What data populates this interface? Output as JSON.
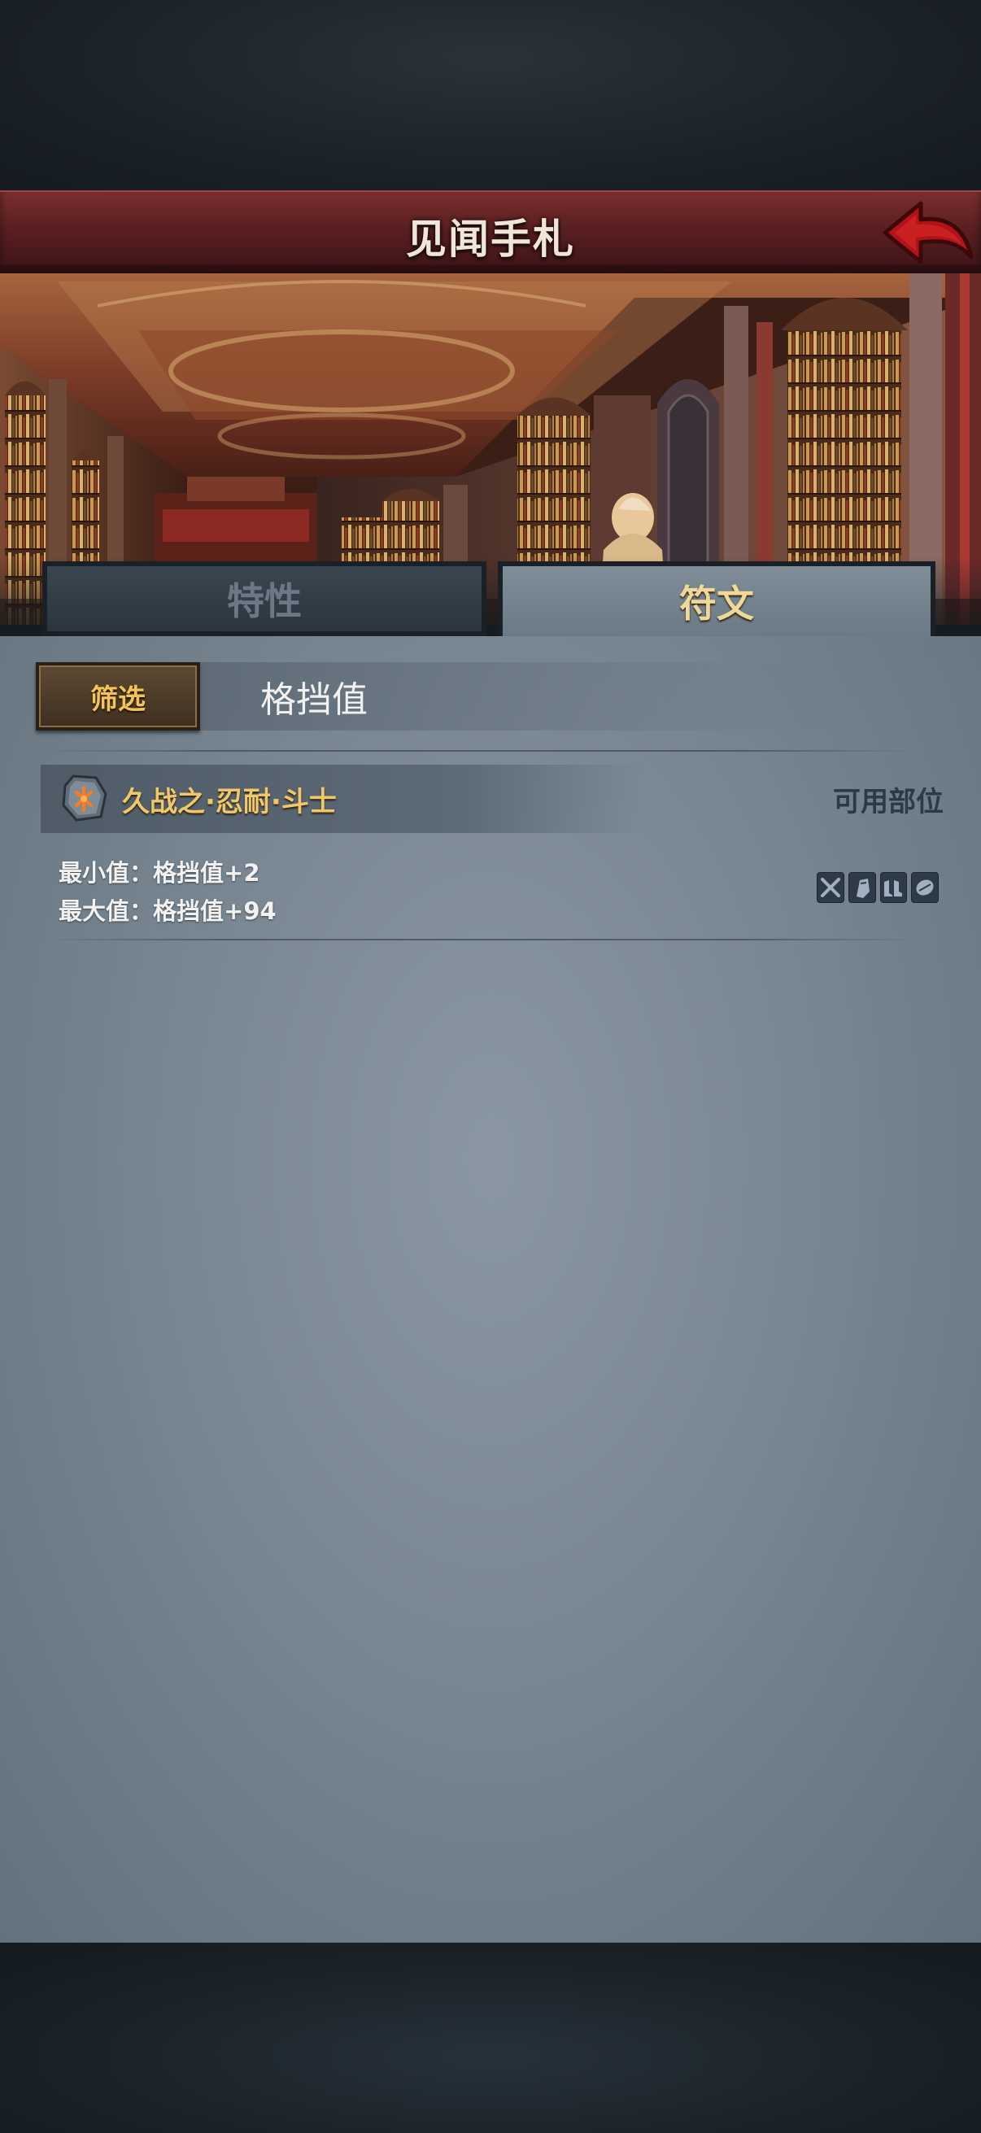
{
  "header": {
    "title": "见闻手札"
  },
  "tabs": [
    {
      "label": "特性",
      "active": false
    },
    {
      "label": "符文",
      "active": true
    }
  ],
  "filter": {
    "button_label": "筛选",
    "selected_value": "格挡值"
  },
  "rune_entry": {
    "name": "久战之·忍耐·斗士",
    "slots_label": "可用部位",
    "icon": "rune-stone-icon",
    "stats": [
      {
        "label": "最小值",
        "sep": "：",
        "value": "格挡值+2"
      },
      {
        "label": "最大值",
        "sep": "：",
        "value": "格挡值+94"
      }
    ],
    "slot_icons": [
      "weapon-slot-icon",
      "armor-slot-icon",
      "boots-slot-icon",
      "shield-slot-icon"
    ]
  },
  "colors": {
    "header_red": "#5a1f21",
    "rune_name_gold": "#f0c869",
    "filter_gold": "#f4c35a",
    "panel_gray": "#75838f"
  }
}
